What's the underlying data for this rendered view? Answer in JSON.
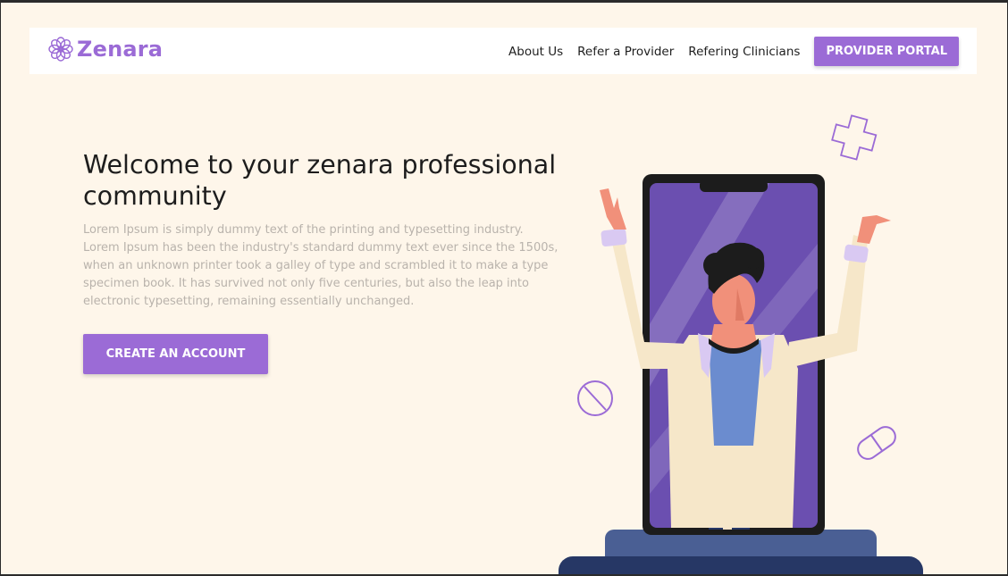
{
  "brand": {
    "name": "Zenara",
    "logo_icon": "flower-logo-icon",
    "color": "#9b6bd6"
  },
  "nav": {
    "links": [
      "About Us",
      "Refer a Provider",
      "Refering Clinicians"
    ],
    "portal_button": "PROVIDER PORTAL"
  },
  "hero": {
    "title": "Welcome to your zenara professional community",
    "description": "Lorem Ipsum is simply dummy text of the printing and typesetting industry. Lorem Ipsum has been the industry's standard dummy text ever since the 1500s, when an unknown printer took a galley of type and scrambled it to make a type specimen book. It has survived not only five centuries, but also the leap into electronic typesetting, remaining essentially unchanged.",
    "cta": "CREATE AN ACCOUNT"
  },
  "illustration": {
    "subject": "doctor-in-phone-illustration",
    "decorations": [
      "medical-cross-icon",
      "pill-round-icon",
      "capsule-icon"
    ]
  },
  "colors": {
    "background": "#fef6ea",
    "accent": "#9b6bd6",
    "phone_screen": "#6b4fb0",
    "pedestal": "#4a5f94",
    "pedestal_base": "#263765"
  }
}
